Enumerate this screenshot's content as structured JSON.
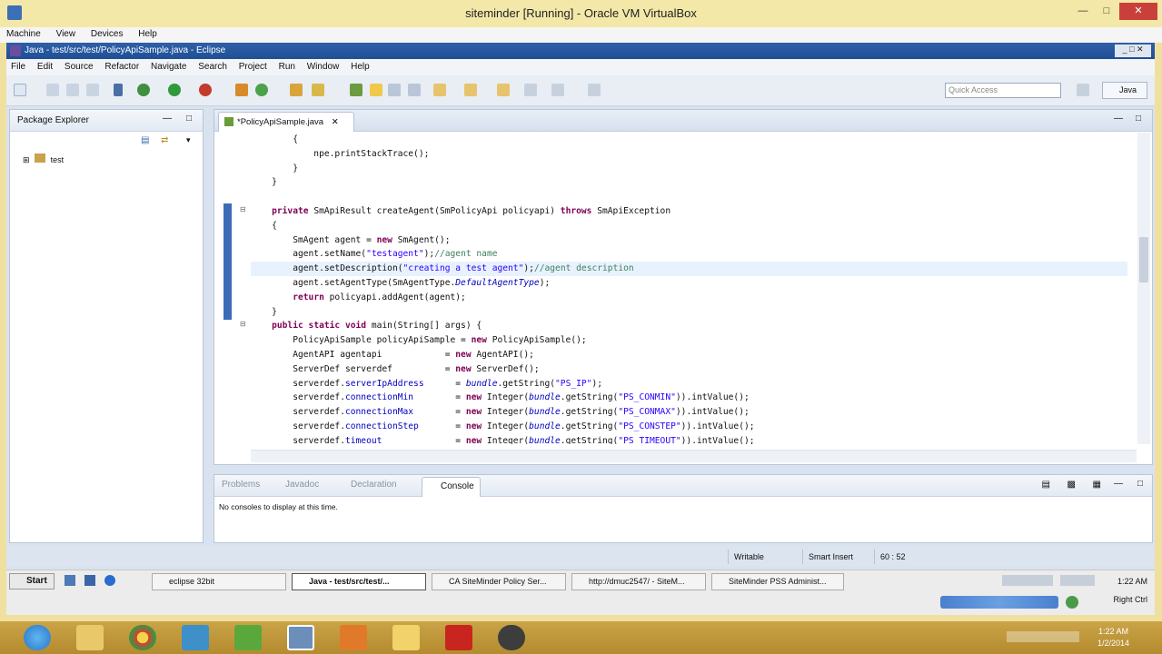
{
  "vbox": {
    "title": "siteminder [Running] - Oracle VM VirtualBox",
    "menu": [
      "Machine",
      "View",
      "Devices",
      "Help"
    ],
    "status_text": "Right Ctrl"
  },
  "eclipse": {
    "title": "Java - test/src/test/PolicyApiSample.java - Eclipse",
    "menu": [
      "File",
      "Edit",
      "Source",
      "Refactor",
      "Navigate",
      "Search",
      "Project",
      "Run",
      "Window",
      "Help"
    ],
    "quick_access_placeholder": "Quick Access",
    "perspective_label": "Java",
    "package_explorer": {
      "title": "Package Explorer",
      "items": [
        "test"
      ]
    },
    "editor": {
      "tab_label": "*PolicyApiSample.java",
      "cursor_line_index": 8
    },
    "bottom_panel": {
      "tabs": [
        "Problems",
        "Javadoc",
        "Declaration",
        "Console"
      ],
      "active_tab": "Console",
      "message": "No consoles to display at this time."
    },
    "status_bar": {
      "writable": "Writable",
      "insert_mode": "Smart Insert",
      "position": "60 : 52"
    }
  },
  "code_lines": [
    [
      {
        "t": "        {",
        "c": ""
      }
    ],
    [
      {
        "t": "            npe.printStackTrace();",
        "c": ""
      }
    ],
    [
      {
        "t": "        }",
        "c": ""
      }
    ],
    [
      {
        "t": "    }",
        "c": ""
      }
    ],
    [
      {
        "t": "",
        "c": ""
      }
    ],
    [
      {
        "t": "    ",
        "c": ""
      },
      {
        "t": "private",
        "c": "kw"
      },
      {
        "t": " SmApiResult createAgent(SmPolicyApi policyapi) ",
        "c": ""
      },
      {
        "t": "throws",
        "c": "kw"
      },
      {
        "t": " SmApiException",
        "c": ""
      }
    ],
    [
      {
        "t": "    {",
        "c": ""
      }
    ],
    [
      {
        "t": "        SmAgent agent = ",
        "c": ""
      },
      {
        "t": "new",
        "c": "kw"
      },
      {
        "t": " SmAgent();",
        "c": ""
      }
    ],
    [
      {
        "t": "        agent.setName(",
        "c": ""
      },
      {
        "t": "\"testagent\"",
        "c": "str"
      },
      {
        "t": ");",
        "c": ""
      },
      {
        "t": "//agent name",
        "c": "cm"
      }
    ],
    [
      {
        "t": "        agent.setDescription(",
        "c": ""
      },
      {
        "t": "\"creating a test agent\"",
        "c": "str"
      },
      {
        "t": ");",
        "c": ""
      },
      {
        "t": "//agent description",
        "c": "cm"
      }
    ],
    [
      {
        "t": "        agent.setAgentType(SmAgentType.",
        "c": ""
      },
      {
        "t": "DefaultAgentType",
        "c": "ital"
      },
      {
        "t": ");",
        "c": ""
      }
    ],
    [
      {
        "t": "        ",
        "c": ""
      },
      {
        "t": "return",
        "c": "kw"
      },
      {
        "t": " policyapi.addAgent(agent);",
        "c": ""
      }
    ],
    [
      {
        "t": "    }",
        "c": ""
      }
    ],
    [
      {
        "t": "    ",
        "c": ""
      },
      {
        "t": "public static void",
        "c": "kw"
      },
      {
        "t": " main(String[] args) {",
        "c": ""
      }
    ],
    [
      {
        "t": "        PolicyApiSample policyApiSample = ",
        "c": ""
      },
      {
        "t": "new",
        "c": "kw"
      },
      {
        "t": " PolicyApiSample();",
        "c": ""
      }
    ],
    [
      {
        "t": "        AgentAPI agentapi            = ",
        "c": ""
      },
      {
        "t": "new",
        "c": "kw"
      },
      {
        "t": " AgentAPI();",
        "c": ""
      }
    ],
    [
      {
        "t": "        ServerDef serverdef          = ",
        "c": ""
      },
      {
        "t": "new",
        "c": "kw"
      },
      {
        "t": " ServerDef();",
        "c": ""
      }
    ],
    [
      {
        "t": "        serverdef.",
        "c": ""
      },
      {
        "t": "serverIpAddress",
        "c": "fld"
      },
      {
        "t": "      = ",
        "c": ""
      },
      {
        "t": "bundle",
        "c": "ital"
      },
      {
        "t": ".getString(",
        "c": ""
      },
      {
        "t": "\"PS_IP\"",
        "c": "str"
      },
      {
        "t": ");",
        "c": ""
      }
    ],
    [
      {
        "t": "        serverdef.",
        "c": ""
      },
      {
        "t": "connectionMin",
        "c": "fld"
      },
      {
        "t": "        = ",
        "c": ""
      },
      {
        "t": "new",
        "c": "kw"
      },
      {
        "t": " Integer(",
        "c": ""
      },
      {
        "t": "bundle",
        "c": "ital"
      },
      {
        "t": ".getString(",
        "c": ""
      },
      {
        "t": "\"PS_CONMIN\"",
        "c": "str"
      },
      {
        "t": ")).intValue();",
        "c": ""
      }
    ],
    [
      {
        "t": "        serverdef.",
        "c": ""
      },
      {
        "t": "connectionMax",
        "c": "fld"
      },
      {
        "t": "        = ",
        "c": ""
      },
      {
        "t": "new",
        "c": "kw"
      },
      {
        "t": " Integer(",
        "c": ""
      },
      {
        "t": "bundle",
        "c": "ital"
      },
      {
        "t": ".getString(",
        "c": ""
      },
      {
        "t": "\"PS_CONMAX\"",
        "c": "str"
      },
      {
        "t": ")).intValue();",
        "c": ""
      }
    ],
    [
      {
        "t": "        serverdef.",
        "c": ""
      },
      {
        "t": "connectionStep",
        "c": "fld"
      },
      {
        "t": "       = ",
        "c": ""
      },
      {
        "t": "new",
        "c": "kw"
      },
      {
        "t": " Integer(",
        "c": ""
      },
      {
        "t": "bundle",
        "c": "ital"
      },
      {
        "t": ".getString(",
        "c": ""
      },
      {
        "t": "\"PS_CONSTEP\"",
        "c": "str"
      },
      {
        "t": ")).intValue();",
        "c": ""
      }
    ],
    [
      {
        "t": "        serverdef.",
        "c": ""
      },
      {
        "t": "timeout",
        "c": "fld"
      },
      {
        "t": "              = ",
        "c": ""
      },
      {
        "t": "new",
        "c": "kw"
      },
      {
        "t": " Integer(",
        "c": ""
      },
      {
        "t": "bundle",
        "c": "ital"
      },
      {
        "t": ".getString(",
        "c": ""
      },
      {
        "t": "\"PS_TIMEOUT\"",
        "c": "str"
      },
      {
        "t": ")).intValue();",
        "c": ""
      }
    ]
  ],
  "guest_taskbar": {
    "start_label": "Start",
    "items": [
      "eclipse 32bit",
      "Java - test/src/test/...",
      "CA SiteMinder Policy Ser...",
      "http://dmuc2547/ - SiteM...",
      "SiteMinder PSS Administ..."
    ],
    "active_index": 1,
    "clock": "1:22 AM"
  },
  "host_taskbar": {
    "clock_time": "1:22 AM",
    "clock_date": "1/2/2014"
  },
  "colors": {
    "keyword": "#7f0055",
    "string": "#2a00ff",
    "comment": "#3f7f5f",
    "field": "#0000c0"
  }
}
